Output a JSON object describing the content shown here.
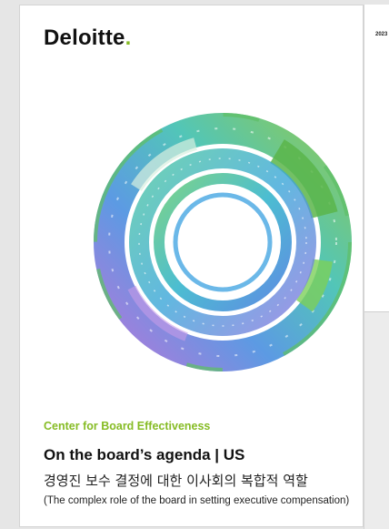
{
  "cover": {
    "brand": "Deloitte",
    "brand_dot": ".",
    "eyebrow": "Center for Board Effectiveness",
    "title": "On the board’s agenda | US",
    "subtitle_ko": "경영진 보수 결정에 대한 이사회의 복합적 역할",
    "subtitle_en": "(The complex role of the board in setting executive compensation)"
  },
  "next_page": {
    "year": "2023"
  },
  "colors": {
    "brand_green": "#86bc25",
    "ring_green": "#6cc24a",
    "ring_teal": "#3fb9c9",
    "ring_blue": "#4a8fe0",
    "ring_purple": "#a86ad6"
  },
  "icons": [
    "deloitte-logo",
    "circular-ring-graphic"
  ]
}
